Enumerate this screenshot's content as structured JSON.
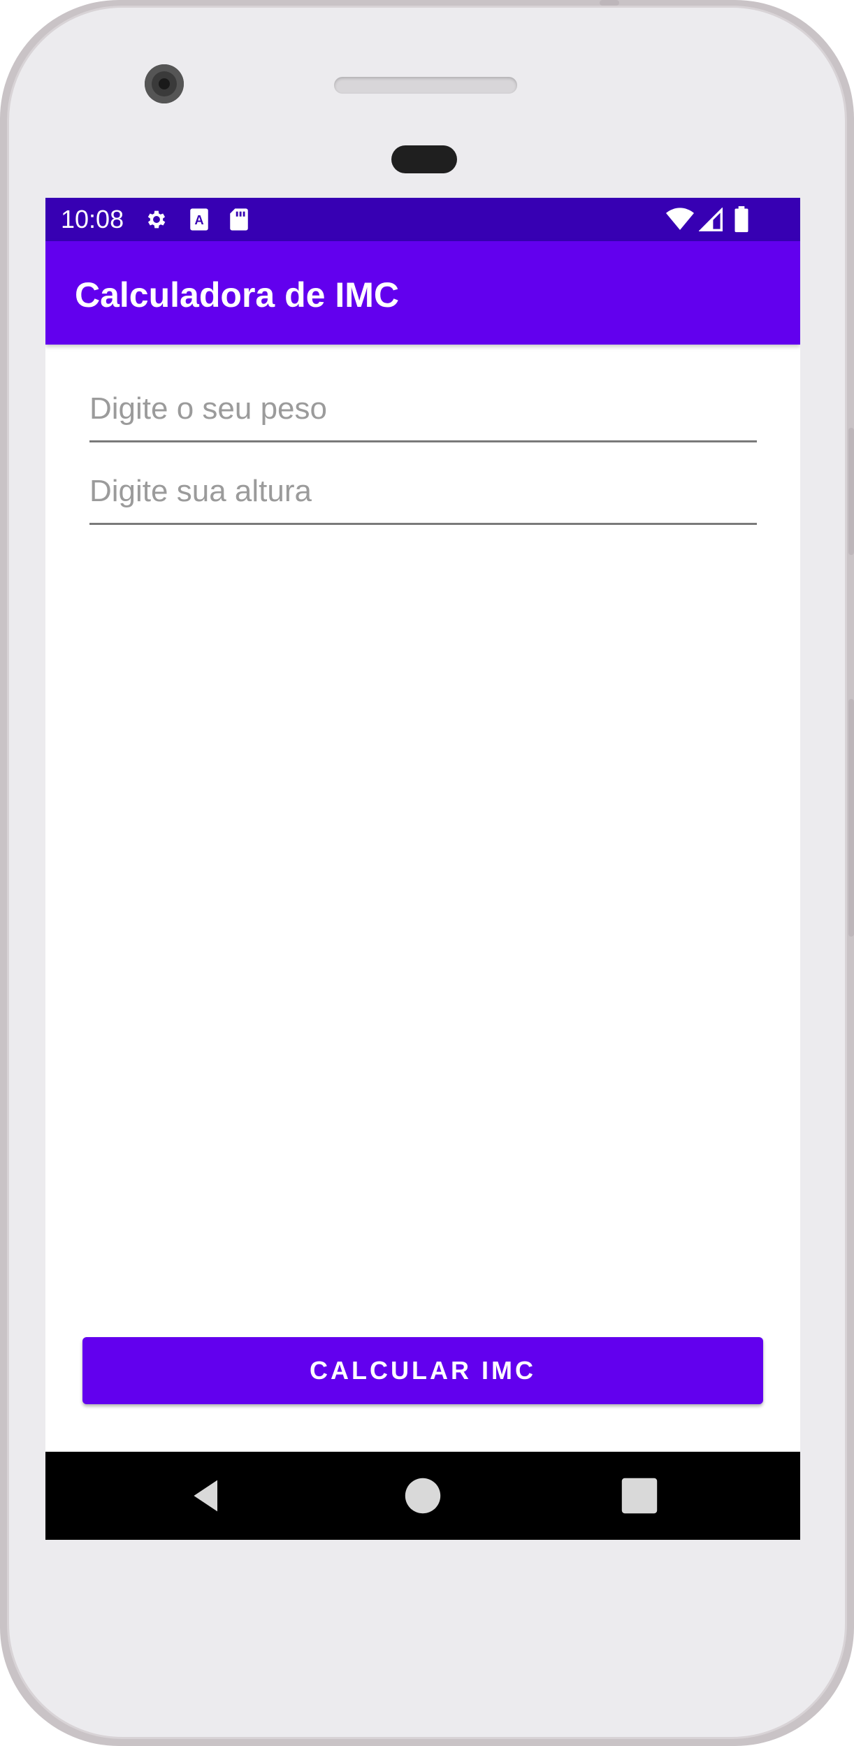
{
  "status_bar": {
    "time": "10:08",
    "icons": [
      "settings-icon",
      "keyboard-a-icon",
      "sd-card-icon",
      "wifi-icon",
      "signal-icon",
      "battery-icon"
    ]
  },
  "app_bar": {
    "title": "Calculadora de IMC"
  },
  "form": {
    "weight_placeholder": "Digite o seu peso",
    "weight_value": "",
    "height_placeholder": "Digite sua altura",
    "height_value": ""
  },
  "actions": {
    "calculate_label": "CALCULAR IMC"
  },
  "navigation": {
    "buttons": [
      "back-icon",
      "home-icon",
      "recents-icon"
    ]
  },
  "colors": {
    "primary": "#6200ee",
    "primary_dark": "#3700b3",
    "nav_bar": "#000000"
  }
}
